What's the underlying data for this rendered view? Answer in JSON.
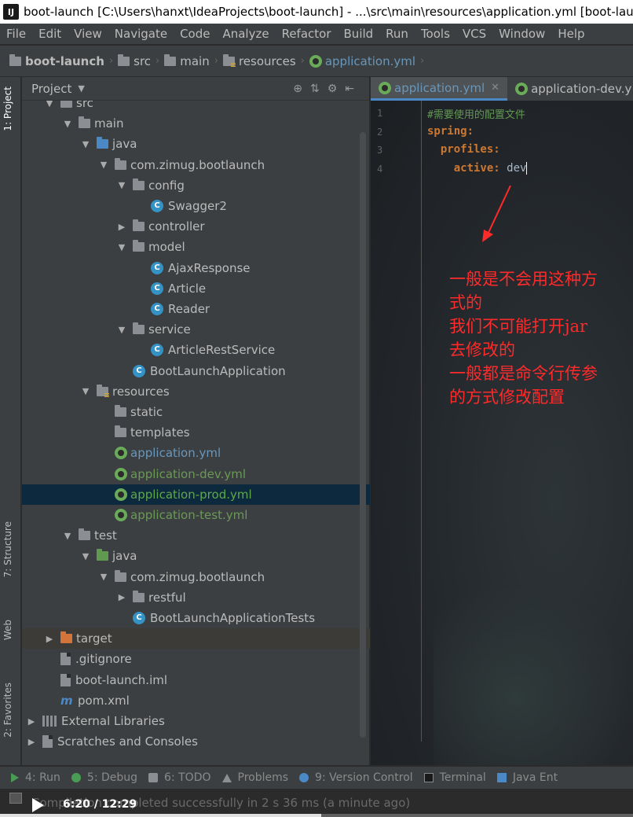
{
  "window": {
    "title": "boot-launch [C:\\Users\\hanxt\\IdeaProjects\\boot-launch] - ...\\src\\main\\resources\\application.yml [boot-launch"
  },
  "menu": [
    "File",
    "Edit",
    "View",
    "Navigate",
    "Code",
    "Analyze",
    "Refactor",
    "Build",
    "Run",
    "Tools",
    "VCS",
    "Window",
    "Help"
  ],
  "breadcrumb": {
    "project": "boot-launch",
    "src": "src",
    "main": "main",
    "resources": "resources",
    "file": "application.yml"
  },
  "left_tabs": {
    "project": "1: Project",
    "structure": "7: Structure",
    "web": "Web",
    "favorites": "2: Favorites"
  },
  "project_panel": {
    "title": "Project",
    "tree": [
      {
        "label": "src",
        "indent": 1,
        "arrow": "down",
        "icon": "folder"
      },
      {
        "label": "main",
        "indent": 2,
        "arrow": "down",
        "icon": "folder"
      },
      {
        "label": "java",
        "indent": 3,
        "arrow": "down",
        "icon": "folder-blue"
      },
      {
        "label": "com.zimug.bootlaunch",
        "indent": 4,
        "arrow": "down",
        "icon": "package"
      },
      {
        "label": "config",
        "indent": 5,
        "arrow": "down",
        "icon": "package"
      },
      {
        "label": "Swagger2",
        "indent": 6,
        "arrow": "none",
        "icon": "class"
      },
      {
        "label": "controller",
        "indent": 5,
        "arrow": "right",
        "icon": "package"
      },
      {
        "label": "model",
        "indent": 5,
        "arrow": "down",
        "icon": "package"
      },
      {
        "label": "AjaxResponse",
        "indent": 6,
        "arrow": "none",
        "icon": "class"
      },
      {
        "label": "Article",
        "indent": 6,
        "arrow": "none",
        "icon": "class"
      },
      {
        "label": "Reader",
        "indent": 6,
        "arrow": "none",
        "icon": "class"
      },
      {
        "label": "service",
        "indent": 5,
        "arrow": "down",
        "icon": "package"
      },
      {
        "label": "ArticleRestService",
        "indent": 6,
        "arrow": "none",
        "icon": "class"
      },
      {
        "label": "BootLaunchApplication",
        "indent": 5,
        "arrow": "none",
        "icon": "class-spring"
      },
      {
        "label": "resources",
        "indent": 3,
        "arrow": "down",
        "icon": "folder-res"
      },
      {
        "label": "static",
        "indent": 4,
        "arrow": "none",
        "icon": "folder"
      },
      {
        "label": "templates",
        "indent": 4,
        "arrow": "none",
        "icon": "folder"
      },
      {
        "label": "application.yml",
        "indent": 4,
        "arrow": "none",
        "icon": "yml",
        "color": "blue"
      },
      {
        "label": "application-dev.yml",
        "indent": 4,
        "arrow": "none",
        "icon": "yml",
        "color": "green"
      },
      {
        "label": "application-prod.yml",
        "indent": 4,
        "arrow": "none",
        "icon": "yml",
        "color": "green2",
        "selected": true
      },
      {
        "label": "application-test.yml",
        "indent": 4,
        "arrow": "none",
        "icon": "yml",
        "color": "green"
      },
      {
        "label": "test",
        "indent": 2,
        "arrow": "down",
        "icon": "folder"
      },
      {
        "label": "java",
        "indent": 3,
        "arrow": "down",
        "icon": "folder-green"
      },
      {
        "label": "com.zimug.bootlaunch",
        "indent": 4,
        "arrow": "down",
        "icon": "package"
      },
      {
        "label": "restful",
        "indent": 5,
        "arrow": "right",
        "icon": "package"
      },
      {
        "label": "BootLaunchApplicationTests",
        "indent": 5,
        "arrow": "none",
        "icon": "class-test"
      },
      {
        "label": "target",
        "indent": 1,
        "arrow": "right",
        "icon": "folder-orange",
        "target": true
      },
      {
        "label": ".gitignore",
        "indent": 1,
        "arrow": "none",
        "icon": "file"
      },
      {
        "label": "boot-launch.iml",
        "indent": 1,
        "arrow": "none",
        "icon": "file"
      },
      {
        "label": "pom.xml",
        "indent": 1,
        "arrow": "none",
        "icon": "maven"
      },
      {
        "label": "External Libraries",
        "indent": 0,
        "arrow": "right",
        "icon": "libs"
      },
      {
        "label": "Scratches and Consoles",
        "indent": 0,
        "arrow": "right",
        "icon": "scratch"
      }
    ]
  },
  "editor": {
    "tabs": [
      {
        "label": "application.yml",
        "active": true
      },
      {
        "label": "application-dev.y",
        "active": false
      }
    ],
    "lines": [
      {
        "num": "1",
        "parts": [
          {
            "t": "#需要使用的配置文件",
            "c": "comment"
          }
        ]
      },
      {
        "num": "2",
        "parts": [
          {
            "t": "spring:",
            "c": "key"
          }
        ]
      },
      {
        "num": "3",
        "parts": [
          {
            "t": "  profiles:",
            "c": "key"
          }
        ]
      },
      {
        "num": "4",
        "parts": [
          {
            "t": "    active:",
            "c": "key"
          },
          {
            "t": " dev",
            "c": "val"
          }
        ]
      }
    ],
    "annotation": [
      "一般是不会用这种方",
      "式的",
      "我们不可能打开jar",
      "去修改的",
      "一般都是命令行传参",
      "的方式修改配置"
    ]
  },
  "bottom_tools": [
    {
      "label": "4: Run",
      "icon": "run"
    },
    {
      "label": "5: Debug",
      "icon": "debug"
    },
    {
      "label": "6: TODO",
      "icon": "todo"
    },
    {
      "label": "Problems",
      "icon": "problems"
    },
    {
      "label": "9: Version Control",
      "icon": "vcs"
    },
    {
      "label": "Terminal",
      "icon": "term"
    },
    {
      "label": "Java Ent",
      "icon": "java"
    }
  ],
  "status": {
    "message": "Compilation completed successfully in 2 s 36 ms (a minute ago)"
  },
  "video": {
    "time": "6:20 / 12:29",
    "progress": 0.508
  },
  "colors": {
    "accent": "#4a88c7",
    "annotation": "#ff2a2a",
    "yaml_key": "#cc7832",
    "selection": "#0d293e"
  }
}
